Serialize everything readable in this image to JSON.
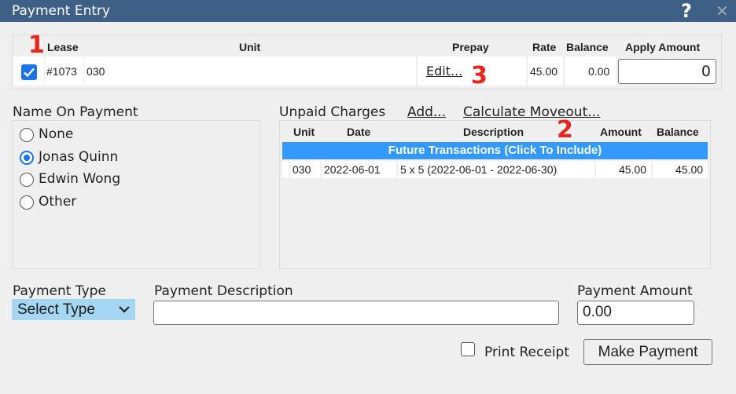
{
  "window": {
    "title": "Payment Entry",
    "help_glyph": "?",
    "close_glyph": "✕"
  },
  "lease_table": {
    "headers": {
      "lease": "Lease",
      "unit": "Unit",
      "prepay": "Prepay",
      "rate": "Rate",
      "balance": "Balance",
      "apply": "Apply Amount"
    },
    "row": {
      "checked": true,
      "lease": "#1073",
      "unit": "030",
      "prepay_link": "Edit...",
      "rate": "45.00",
      "balance": "0.00",
      "apply_amount": "0"
    }
  },
  "name_on_payment": {
    "label": "Name On Payment",
    "options": [
      {
        "label": "None",
        "selected": false
      },
      {
        "label": "Jonas Quinn",
        "selected": true
      },
      {
        "label": "Edwin Wong",
        "selected": false
      },
      {
        "label": "Other",
        "selected": false
      }
    ]
  },
  "unpaid_charges": {
    "label": "Unpaid Charges",
    "add_link": "Add...",
    "moveout_link": "Calculate Moveout...",
    "headers": {
      "unit": "Unit",
      "date": "Date",
      "description": "Description",
      "amount": "Amount",
      "balance": "Balance"
    },
    "future_bar": "Future Transactions (Click To Include)",
    "rows": [
      {
        "unit": "030",
        "date": "2022-06-01",
        "description": "5 x 5 (2022-06-01 - 2022-06-30)",
        "amount": "45.00",
        "balance": "45.00"
      }
    ]
  },
  "payment": {
    "type_label": "Payment Type",
    "type_value": "Select Type",
    "description_label": "Payment Description",
    "description_value": "",
    "amount_label": "Payment Amount",
    "amount_value": "0.00",
    "print_receipt_label": "Print Receipt",
    "print_receipt_checked": false,
    "make_payment_label": "Make Payment"
  },
  "annotations": {
    "a1": "1",
    "a2": "2",
    "a3": "3",
    "color": "#e8241c"
  },
  "colors": {
    "titlebar": "#3e5f86",
    "accent": "#1a73e8",
    "future_bar": "#3399ff",
    "select_bg": "#a6d7f2"
  }
}
